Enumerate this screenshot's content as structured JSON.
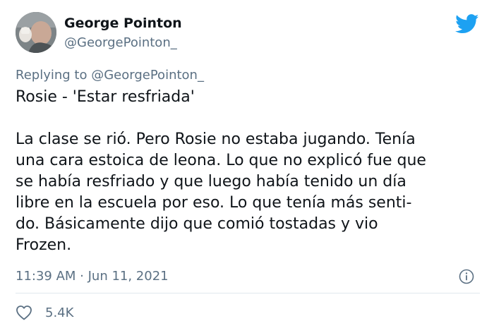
{
  "author": {
    "name": "George Pointon",
    "handle": "@GeorgePointon_"
  },
  "reply": {
    "prefix": "Replying to",
    "mention": "@GeorgePointon_"
  },
  "tweet": {
    "lines": [
      "Rosie - 'Estar resfriada'",
      "",
      "La clase se rió. Pero Rosie no estaba jugando. Tenía",
      "una cara estoica de leona. Lo que no explicó fue que",
      "se había resfriado y que luego había tenido un día",
      "libre en la escuela por eso. Lo que tenía más senti-",
      "do. Básicamente dijo que comió tostadas y vio",
      "Frozen."
    ]
  },
  "meta": {
    "timestamp": "11:39 AM · Jun 11, 2021"
  },
  "engagement": {
    "likes": "5.4K"
  },
  "icons": {
    "logo": "twitter-bird-icon",
    "info": "info-icon",
    "like": "heart-icon"
  },
  "colors": {
    "brand": "#1da1f2",
    "secondary_text": "#5b7083",
    "primary_text": "#0f1419"
  }
}
